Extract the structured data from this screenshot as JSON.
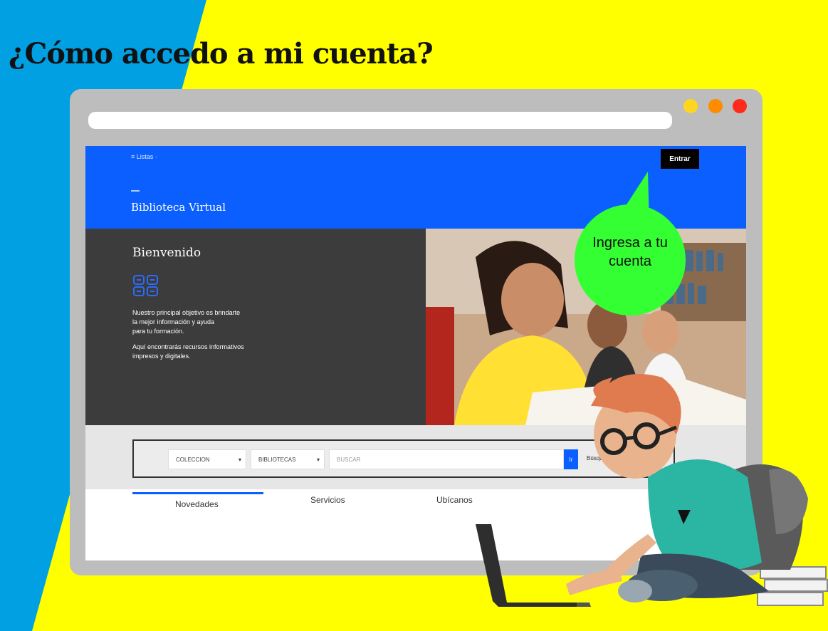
{
  "slide": {
    "title": "¿Cómo accedo a mi cuenta?"
  },
  "site": {
    "lists_link": "≡ Listas ·",
    "login_button": "Entrar",
    "title": "Biblioteca Virtual"
  },
  "hero": {
    "heading": "Bienvenido",
    "paragraph1": [
      "Nuestro principal objetivo es brindarte",
      "la mejor información y ayuda",
      "para tu formación."
    ],
    "paragraph2": [
      "Aquí encontrarás recursos informativos",
      "impresos y digitales."
    ]
  },
  "search": {
    "collection_select": "COLECCION",
    "library_select": "BIBLIOTECAS",
    "placeholder": "BUSCAR",
    "go_label": "Ir",
    "advanced_link": "Búsqueda"
  },
  "tabs": [
    {
      "label": "Novedades",
      "active": true
    },
    {
      "label": "Servicios",
      "active": false
    },
    {
      "label": "Ubícanos",
      "active": false
    }
  ],
  "callout": {
    "text": "Ingresa a tu cuenta"
  },
  "colors": {
    "background": "#ffff00",
    "left_band": "#00a0e3",
    "site_blue": "#0b5fff",
    "callout_green": "#33ff33"
  },
  "icons": [
    "browser-dot-yellow",
    "browser-dot-orange",
    "browser-dot-red",
    "library-logo-icon",
    "chevron-down-icon"
  ]
}
